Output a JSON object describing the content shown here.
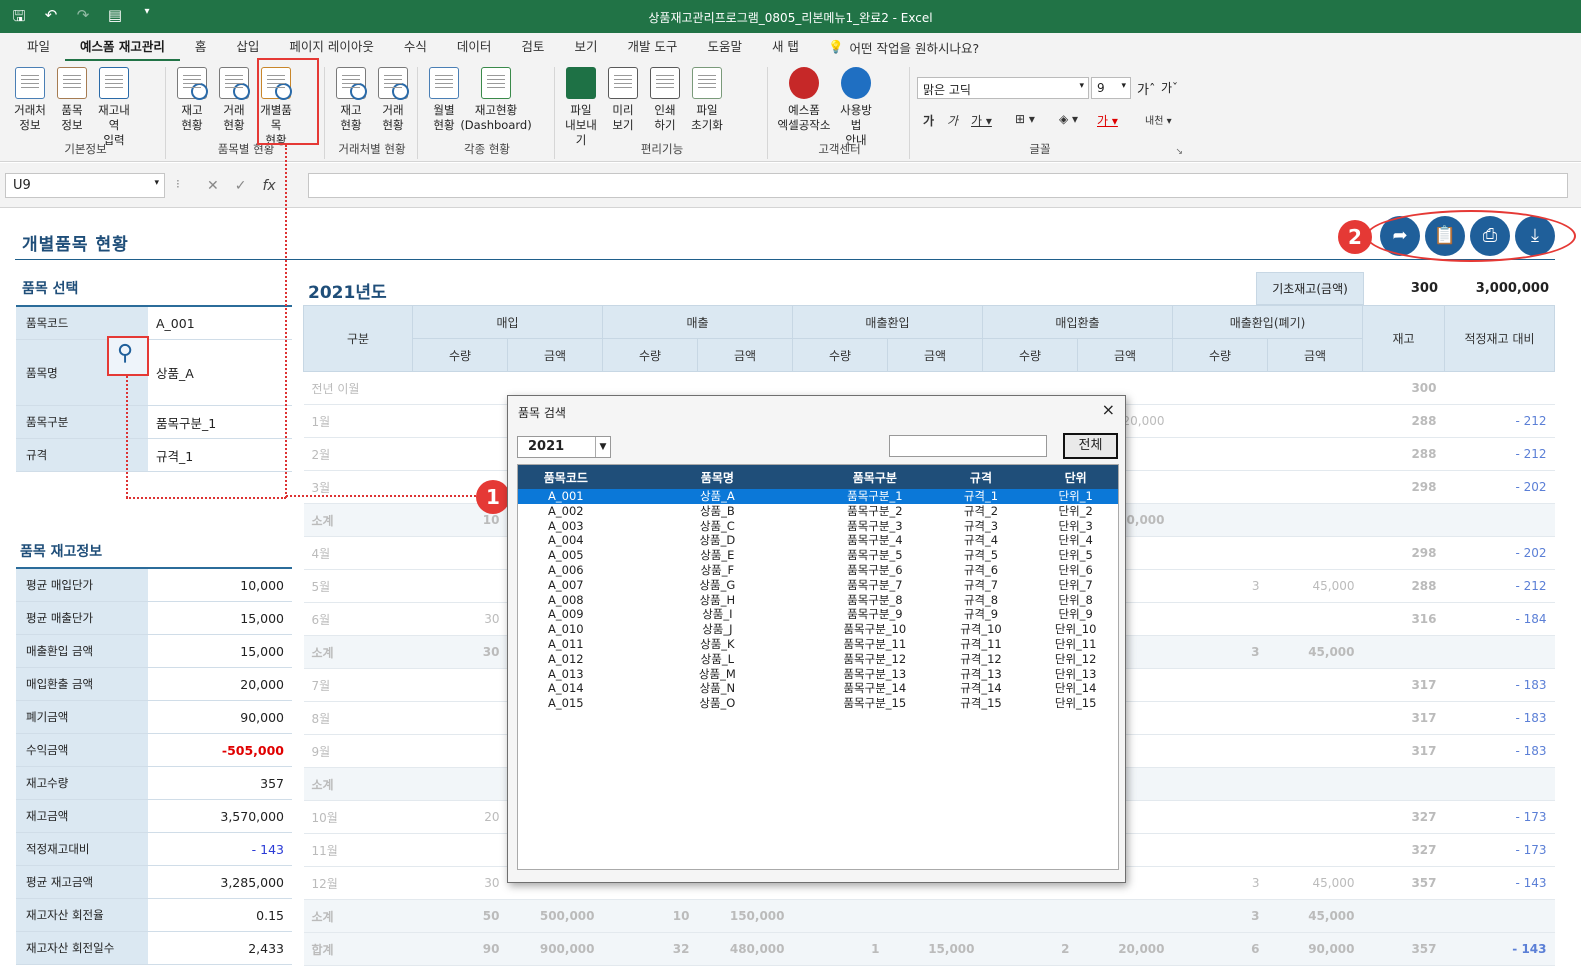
{
  "window": {
    "title": "상품재고관리프로그램_0805_리본메뉴1_완료2  -  Excel"
  },
  "menu": {
    "tabs": [
      "파일",
      "예스폼 재고관리",
      "홈",
      "삽입",
      "페이지 레이아웃",
      "수식",
      "데이터",
      "검토",
      "보기",
      "개발 도구",
      "도움말",
      "새 탭"
    ],
    "tell": "어떤 작업을 원하시나요?"
  },
  "ribbon": {
    "groups": [
      {
        "label": "기본정보",
        "buttons": [
          "거래처\n정보",
          "품목\n정보",
          "재고내역\n입력"
        ]
      },
      {
        "label": "품목별 현황",
        "buttons": [
          "재고\n현황",
          "거래\n현황",
          "개별품목\n현황"
        ]
      },
      {
        "label": "거래처별 현황",
        "buttons": [
          "재고\n현황",
          "거래\n현황"
        ]
      },
      {
        "label": "각종 현황",
        "buttons": [
          "월별\n현황",
          "재고현황\n(Dashboard)"
        ]
      },
      {
        "label": "편리기능",
        "buttons": [
          "파일\n내보내기",
          "미리\n보기",
          "인쇄\n하기",
          "파일\n초기화"
        ]
      },
      {
        "label": "고객센터",
        "buttons": [
          "예스폼\n엑셀공작소",
          "사용방법\n안내"
        ]
      }
    ],
    "font_label": "글꼴",
    "font_name": "맑은 고딕",
    "font_size": "9"
  },
  "formula": {
    "namebox": "U9"
  },
  "page": {
    "title": "개별품목 현황",
    "year": "2021년도",
    "base_label": "기초재고(금액)",
    "base_qty": "300",
    "base_amount": "3,000,000"
  },
  "item_select": {
    "title": "품목 선택",
    "rows": [
      {
        "k": "품목코드",
        "v": "A_001"
      },
      {
        "k": "품목명",
        "v": "상품_A"
      },
      {
        "k": "품목구분",
        "v": "품목구분_1"
      },
      {
        "k": "규격",
        "v": "규격_1"
      }
    ]
  },
  "stock_info": {
    "title": "품목 재고정보",
    "rows": [
      {
        "k": "평균 매입단가",
        "v": "10,000"
      },
      {
        "k": "평균 매출단가",
        "v": "15,000"
      },
      {
        "k": "매출환입 금액",
        "v": "15,000"
      },
      {
        "k": "매입환출 금액",
        "v": "20,000"
      },
      {
        "k": "폐기금액",
        "v": "90,000"
      },
      {
        "k": "수익금액",
        "v": "-505,000"
      },
      {
        "k": "재고수량",
        "v": "357"
      },
      {
        "k": "재고금액",
        "v": "3,570,000"
      },
      {
        "k": "적정재고대비",
        "v": "- 143"
      },
      {
        "k": "평균 재고금액",
        "v": "3,285,000"
      },
      {
        "k": "재고자산 회전율",
        "v": "0.15"
      },
      {
        "k": "재고자산 회전일수",
        "v": "2,433"
      }
    ]
  },
  "table": {
    "groups": [
      "매입",
      "매출",
      "매출환입",
      "매입환출",
      "매출환입(폐기)"
    ],
    "sub": [
      "수량",
      "금액"
    ],
    "col_first": "구분",
    "col_stock": "재고",
    "col_ratio": "적정재고 대비",
    "rows": [
      {
        "label": "전년 이월",
        "cells": [
          "",
          "",
          "",
          "",
          "",
          "",
          "",
          "",
          "",
          "",
          "300",
          ""
        ],
        "sub": false
      },
      {
        "label": "1월",
        "cells": [
          "",
          "",
          "",
          "",
          "",
          "",
          "",
          "20,000",
          "",
          "",
          "288",
          "- 212"
        ],
        "sub": false
      },
      {
        "label": "2월",
        "cells": [
          "",
          "",
          "",
          "",
          "",
          "",
          "",
          "",
          "",
          "",
          "288",
          "- 212"
        ],
        "sub": false
      },
      {
        "label": "3월",
        "cells": [
          "",
          "",
          "",
          "",
          "",
          "",
          "",
          "",
          "",
          "",
          "298",
          "- 202"
        ],
        "sub": false
      },
      {
        "label": "소계",
        "cells": [
          "10",
          "",
          "",
          "",
          "",
          "",
          "",
          "20,000",
          "",
          "",
          "",
          ""
        ],
        "sub": true
      },
      {
        "label": "4월",
        "cells": [
          "",
          "",
          "",
          "",
          "",
          "",
          "",
          "",
          "",
          "",
          "298",
          "- 202"
        ],
        "sub": false
      },
      {
        "label": "5월",
        "cells": [
          "",
          "",
          "",
          "",
          "",
          "",
          "",
          "",
          "3",
          "45,000",
          "288",
          "- 212"
        ],
        "sub": false
      },
      {
        "label": "6월",
        "cells": [
          "30",
          "",
          "",
          "",
          "",
          "",
          "",
          "",
          "",
          "",
          "316",
          "- 184"
        ],
        "sub": false
      },
      {
        "label": "소계",
        "cells": [
          "30",
          "",
          "",
          "",
          "",
          "",
          "",
          "",
          "3",
          "45,000",
          "",
          ""
        ],
        "sub": true
      },
      {
        "label": "7월",
        "cells": [
          "",
          "",
          "",
          "",
          "",
          "",
          "",
          "",
          "",
          "",
          "317",
          "- 183"
        ],
        "sub": false
      },
      {
        "label": "8월",
        "cells": [
          "",
          "",
          "",
          "",
          "",
          "",
          "",
          "",
          "",
          "",
          "317",
          "- 183"
        ],
        "sub": false
      },
      {
        "label": "9월",
        "cells": [
          "",
          "",
          "",
          "",
          "",
          "",
          "",
          "",
          "",
          "",
          "317",
          "- 183"
        ],
        "sub": false
      },
      {
        "label": "소계",
        "cells": [
          "",
          "",
          "",
          "",
          "",
          "",
          "",
          "",
          "",
          "",
          "",
          ""
        ],
        "sub": true
      },
      {
        "label": "10월",
        "cells": [
          "20",
          "",
          "",
          "",
          "",
          "",
          "",
          "",
          "",
          "",
          "327",
          "- 173"
        ],
        "sub": false
      },
      {
        "label": "11월",
        "cells": [
          "",
          "",
          "",
          "",
          "",
          "",
          "",
          "",
          "",
          "",
          "327",
          "- 173"
        ],
        "sub": false
      },
      {
        "label": "12월",
        "cells": [
          "30",
          "",
          "",
          "",
          "",
          "",
          "",
          "",
          "3",
          "45,000",
          "357",
          "- 143"
        ],
        "sub": false
      },
      {
        "label": "소계",
        "cells": [
          "50",
          "500,000",
          "10",
          "150,000",
          "",
          "",
          "",
          "",
          "3",
          "45,000",
          "",
          ""
        ],
        "sub": true
      },
      {
        "label": "합계",
        "cells": [
          "90",
          "900,000",
          "32",
          "480,000",
          "1",
          "15,000",
          "2",
          "20,000",
          "6",
          "90,000",
          "357",
          "- 143"
        ],
        "sub": true
      }
    ]
  },
  "dialog": {
    "title": "품목 검색",
    "close": "×",
    "year": "2021",
    "all_button": "전체",
    "headers": [
      "품목코드",
      "품목명",
      "품목구분",
      "규격",
      "단위"
    ],
    "items": [
      [
        "A_001",
        "상품_A",
        "품목구분_1",
        "규격_1",
        "단위_1"
      ],
      [
        "A_002",
        "상품_B",
        "품목구분_2",
        "규격_2",
        "단위_2"
      ],
      [
        "A_003",
        "상품_C",
        "품목구분_3",
        "규격_3",
        "단위_3"
      ],
      [
        "A_004",
        "상품_D",
        "품목구분_4",
        "규격_4",
        "단위_4"
      ],
      [
        "A_005",
        "상품_E",
        "품목구분_5",
        "규격_5",
        "단위_5"
      ],
      [
        "A_006",
        "상품_F",
        "품목구분_6",
        "규격_6",
        "단위_6"
      ],
      [
        "A_007",
        "상품_G",
        "품목구분_7",
        "규격_7",
        "단위_7"
      ],
      [
        "A_008",
        "상품_H",
        "품목구분_8",
        "규격_8",
        "단위_8"
      ],
      [
        "A_009",
        "상품_I",
        "품목구분_9",
        "규격_9",
        "단위_9"
      ],
      [
        "A_010",
        "상품_J",
        "품목구분_10",
        "규격_10",
        "단위_10"
      ],
      [
        "A_011",
        "상품_K",
        "품목구분_11",
        "규격_11",
        "단위_11"
      ],
      [
        "A_012",
        "상품_L",
        "품목구분_12",
        "규격_12",
        "단위_12"
      ],
      [
        "A_013",
        "상품_M",
        "품목구분_13",
        "규격_13",
        "단위_13"
      ],
      [
        "A_014",
        "상품_N",
        "품목구분_14",
        "규격_14",
        "단위_14"
      ],
      [
        "A_015",
        "상품_O",
        "품목구분_15",
        "규격_15",
        "단위_15"
      ]
    ]
  },
  "annotations": {
    "one": "1",
    "two": "2"
  },
  "colors": {
    "excel_green": "#217346",
    "header_blue": "#1f4e79",
    "accent_red": "#e53935",
    "negative_red": "#e00000",
    "negative_blue": "#2b3bd6"
  }
}
